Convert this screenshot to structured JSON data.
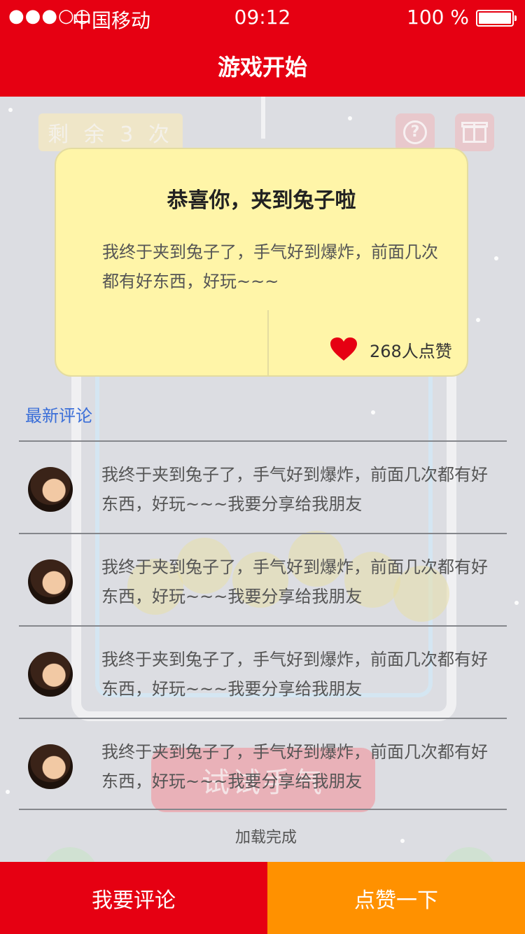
{
  "status_bar": {
    "signal": "●●●○○",
    "carrier": "中国移动",
    "time": "09:12",
    "battery": "100 %"
  },
  "nav": {
    "title": "游戏开始"
  },
  "background_game": {
    "remaining": "剩 余 3 次",
    "start_button": "试试手气",
    "help_icon_glyph": "?"
  },
  "popup": {
    "title": "恭喜你，夹到兔子啦",
    "message": "我终于夹到兔子了，手气好到爆炸，前面几次都有好东西，好玩~~~",
    "like_count": "268人点赞",
    "heart_color": "#e60012"
  },
  "comments": {
    "section_title": "最新评论",
    "items": [
      {
        "text": "我终于夹到兔子了，手气好到爆炸，前面几次都有好东西，好玩~~~我要分享给我朋友"
      },
      {
        "text": "我终于夹到兔子了，手气好到爆炸，前面几次都有好东西，好玩~~~我要分享给我朋友"
      },
      {
        "text": "我终于夹到兔子了，手气好到爆炸，前面几次都有好东西，好玩~~~我要分享给我朋友"
      },
      {
        "text": "我终于夹到兔子了，手气好到爆炸，前面几次都有好东西，好玩~~~我要分享给我朋友"
      }
    ],
    "load_status": "加载完成"
  },
  "bottom": {
    "comment_button": "我要评论",
    "like_button": "点赞一下"
  },
  "colors": {
    "brand_red": "#e60012",
    "accent_orange": "#ff9100",
    "popup_yellow": "#fff5a8",
    "link_blue": "#3a6ed8"
  }
}
